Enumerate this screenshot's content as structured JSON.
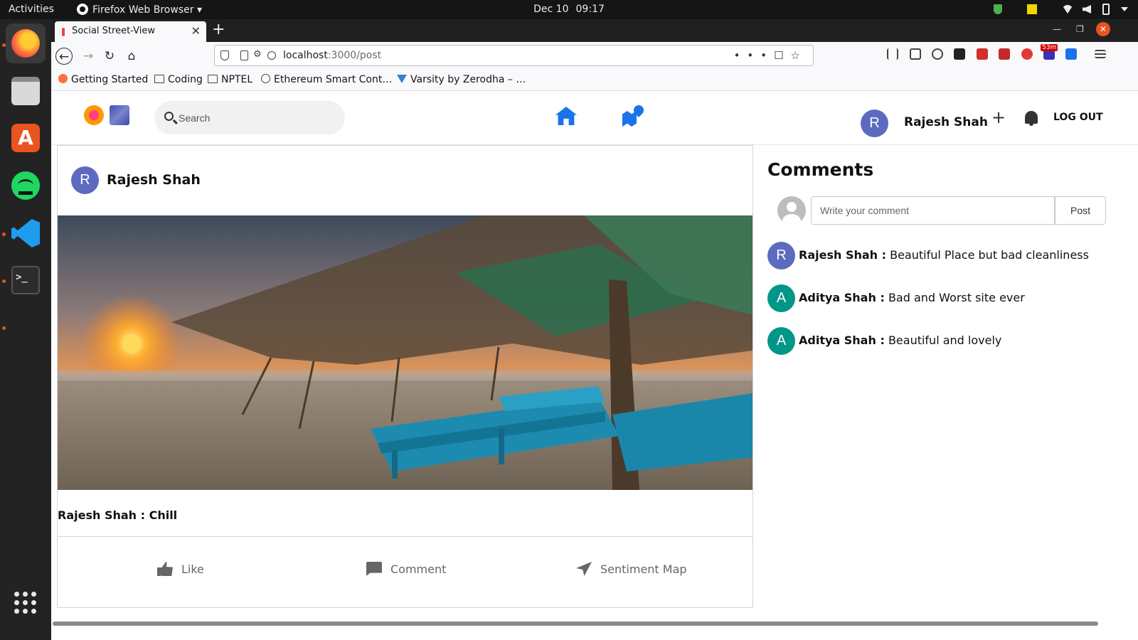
{
  "system_bar": {
    "activities": "Activities",
    "app_menu": "Firefox Web Browser",
    "date": "Dec 10",
    "time": "09:17"
  },
  "dock": {
    "apps": [
      "firefox-icon",
      "files-icon",
      "software-store-icon",
      "spotify-icon",
      "vscode-icon",
      "terminal-icon"
    ],
    "show_apps": "apps-grid-icon"
  },
  "browser": {
    "tab_title": "Social Street-View",
    "url_host": "localhost",
    "url_path": ":3000/post",
    "toolbar_badge": "53m",
    "bookmarks": [
      "Getting Started",
      "Coding",
      "NPTEL",
      "Ethereum Smart Cont…",
      "Varsity by Zerodha – …"
    ]
  },
  "header": {
    "search_placeholder": "Search",
    "user_avatar_letter": "R",
    "user_name": "Rajesh Shah",
    "logout": "LOG OUT"
  },
  "post": {
    "author_letter": "R",
    "author": "Rajesh Shah",
    "caption": "Rajesh Shah : Chill",
    "actions": {
      "like": "Like",
      "comment": "Comment",
      "sentiment": "Sentiment Map"
    }
  },
  "comments": {
    "title": "Comments",
    "input_placeholder": "Write your comment",
    "post_button": "Post",
    "items": [
      {
        "letter": "R",
        "author": "Rajesh Shah :",
        "text": "Beautiful Place but bad cleanliness",
        "color": "#5c6bc0"
      },
      {
        "letter": "A",
        "author": "Aditya Shah :",
        "text": "Bad and Worst site ever",
        "color": "#009688"
      },
      {
        "letter": "A",
        "author": "Aditya Shah :",
        "text": "Beautiful and lovely",
        "color": "#009688"
      }
    ]
  }
}
